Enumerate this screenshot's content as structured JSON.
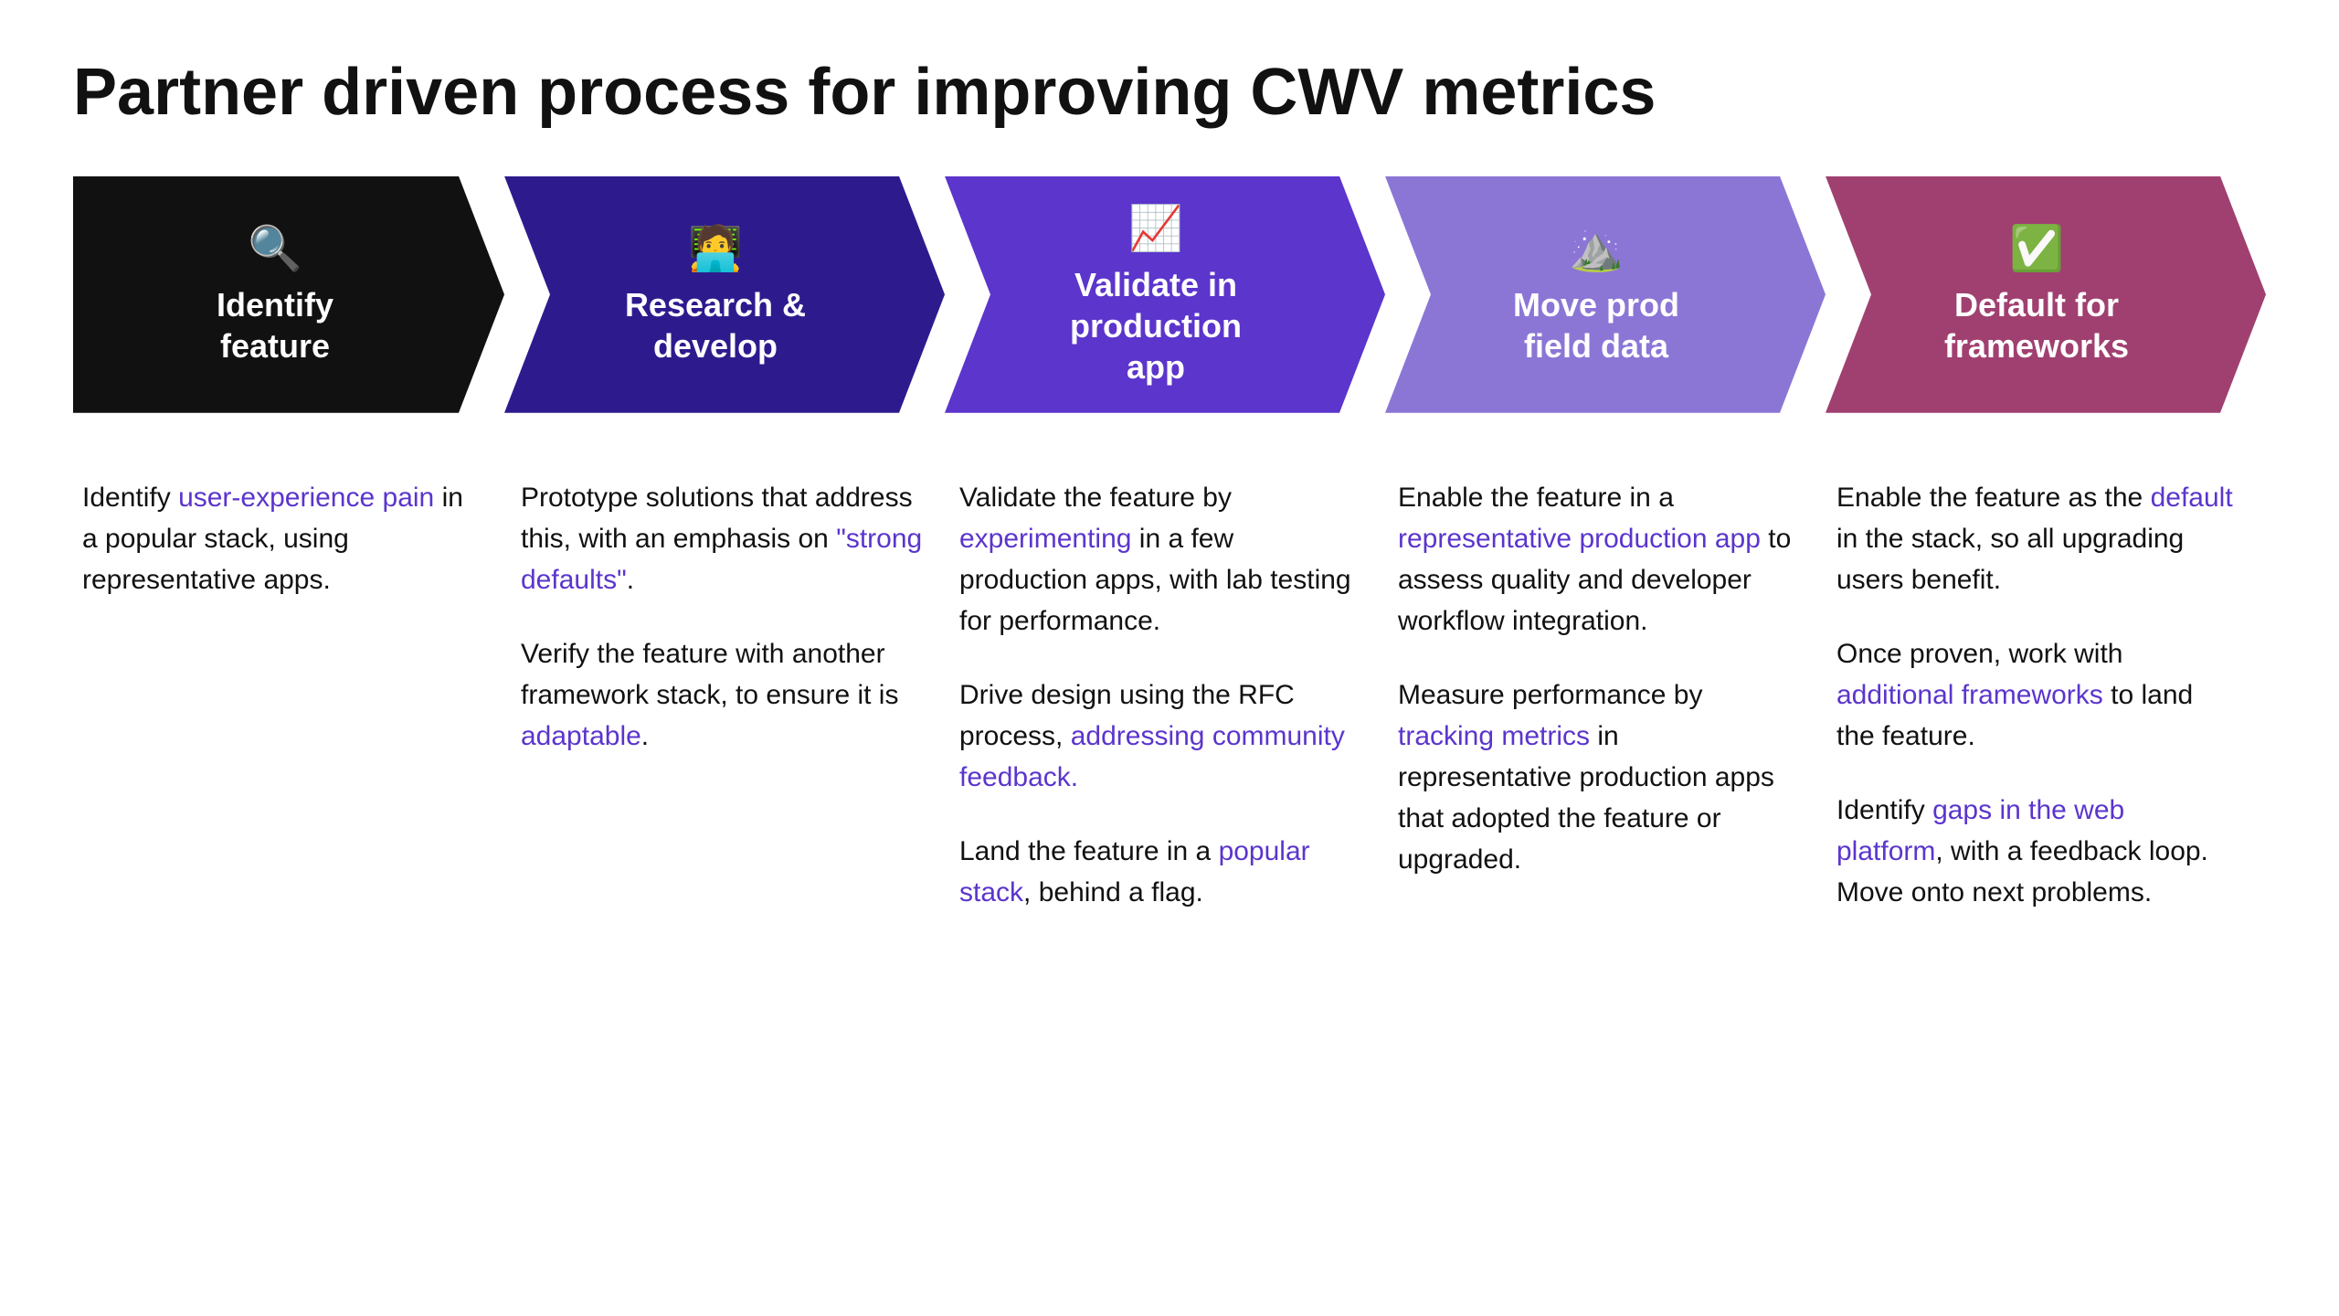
{
  "page": {
    "title": "Partner driven process for improving CWV metrics"
  },
  "arrows": [
    {
      "id": "identify",
      "label": "Identify\nfeature",
      "icon": "🔍",
      "colorClass": "arrow-1"
    },
    {
      "id": "research",
      "label": "Research &\ndevelop",
      "icon": "🧑‍💻",
      "colorClass": "arrow-2"
    },
    {
      "id": "validate",
      "label": "Validate in\nproduction\napp",
      "icon": "📈",
      "colorClass": "arrow-3"
    },
    {
      "id": "move",
      "label": "Move prod\nfield data",
      "icon": "⛰️",
      "colorClass": "arrow-4"
    },
    {
      "id": "default",
      "label": "Default for\nframeworks",
      "icon": "✅",
      "colorClass": "arrow-5"
    }
  ],
  "columns": [
    {
      "id": "identify-content",
      "paragraphs": [
        {
          "parts": [
            {
              "text": "Identify ",
              "type": "normal"
            },
            {
              "text": "user-experience pain",
              "type": "link-purple"
            },
            {
              "text": " in a popular stack, using representative apps.",
              "type": "normal"
            }
          ]
        }
      ]
    },
    {
      "id": "research-content",
      "paragraphs": [
        {
          "parts": [
            {
              "text": "Prototype solutions that address this, with an emphasis on ",
              "type": "normal"
            },
            {
              "text": "\"strong defaults\"",
              "type": "link-purple"
            },
            {
              "text": ".",
              "type": "normal"
            }
          ]
        },
        {
          "parts": [
            {
              "text": "Verify the feature with another framework stack, to ensure it is ",
              "type": "normal"
            },
            {
              "text": "adaptable",
              "type": "link-purple"
            },
            {
              "text": ".",
              "type": "normal"
            }
          ]
        }
      ]
    },
    {
      "id": "validate-content",
      "paragraphs": [
        {
          "parts": [
            {
              "text": "Validate the feature by ",
              "type": "normal"
            },
            {
              "text": "experimenting",
              "type": "link-purple"
            },
            {
              "text": " in a few production apps, with lab testing for performance.",
              "type": "normal"
            }
          ]
        },
        {
          "parts": [
            {
              "text": "Drive design using the RFC process, ",
              "type": "normal"
            },
            {
              "text": "addressing community feedback.",
              "type": "link-purple"
            }
          ]
        },
        {
          "parts": [
            {
              "text": "Land the feature in a ",
              "type": "normal"
            },
            {
              "text": "popular stack",
              "type": "link-purple"
            },
            {
              "text": ", behind a flag.",
              "type": "normal"
            }
          ]
        }
      ]
    },
    {
      "id": "move-content",
      "paragraphs": [
        {
          "parts": [
            {
              "text": "Enable the feature in a ",
              "type": "normal"
            },
            {
              "text": "representative production app",
              "type": "link-purple"
            },
            {
              "text": " to assess quality and developer workflow integration.",
              "type": "normal"
            }
          ]
        },
        {
          "parts": [
            {
              "text": "Measure performance by ",
              "type": "normal"
            },
            {
              "text": "tracking metrics",
              "type": "link-purple"
            },
            {
              "text": " in representative production apps that adopted the feature or upgraded.",
              "type": "normal"
            }
          ]
        }
      ]
    },
    {
      "id": "default-content",
      "paragraphs": [
        {
          "parts": [
            {
              "text": "Enable the feature as the ",
              "type": "normal"
            },
            {
              "text": "default",
              "type": "link-purple"
            },
            {
              "text": " in the stack, so all upgrading users benefit.",
              "type": "normal"
            }
          ]
        },
        {
          "parts": [
            {
              "text": "Once proven, work with ",
              "type": "normal"
            },
            {
              "text": "additional frameworks",
              "type": "link-purple"
            },
            {
              "text": " to land the feature.",
              "type": "normal"
            }
          ]
        },
        {
          "parts": [
            {
              "text": "Identify ",
              "type": "normal"
            },
            {
              "text": "gaps in the web platform",
              "type": "link-purple"
            },
            {
              "text": ", with a feedback loop. Move onto next problems.",
              "type": "normal"
            }
          ]
        }
      ]
    }
  ]
}
